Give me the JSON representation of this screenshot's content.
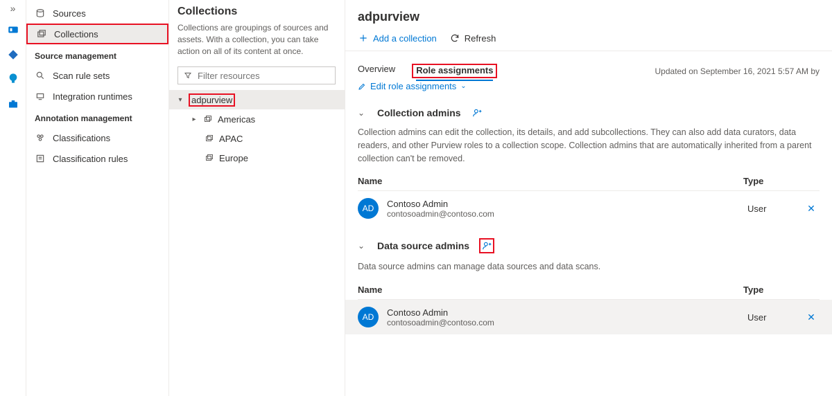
{
  "rail": {
    "expand_label": "Expand"
  },
  "sidebar": {
    "items": [
      {
        "label": "Sources"
      },
      {
        "label": "Collections"
      }
    ],
    "heading1": "Source management",
    "mgmt": [
      {
        "label": "Scan rule sets"
      },
      {
        "label": "Integration runtimes"
      }
    ],
    "heading2": "Annotation management",
    "ann": [
      {
        "label": "Classifications"
      },
      {
        "label": "Classification rules"
      }
    ]
  },
  "tree": {
    "title": "Collections",
    "subtitle": "Collections are groupings of sources and assets. With a collection, you can take action on all of its content at once.",
    "filter_placeholder": "Filter resources",
    "root": "adpurview",
    "children": [
      "Americas",
      "APAC",
      "Europe"
    ]
  },
  "main": {
    "title": "adpurview",
    "toolbar": {
      "add": "Add a collection",
      "refresh": "Refresh"
    },
    "tabs": {
      "overview": "Overview",
      "role": "Role assignments"
    },
    "updated": "Updated on September 16, 2021 5:57 AM by",
    "edit": "Edit role assignments",
    "sec1": {
      "title": "Collection admins",
      "desc": "Collection admins can edit the collection, its details, and add subcollections. They can also add data curators, data readers, and other Purview roles to a collection scope. Collection admins that are automatically inherited from a parent collection can't be removed.",
      "name_col": "Name",
      "type_col": "Type",
      "row": {
        "initials": "AD",
        "name": "Contoso Admin",
        "email": "contosoadmin@contoso.com",
        "type": "User"
      }
    },
    "sec2": {
      "title": "Data source admins",
      "desc": "Data source admins can manage data sources and data scans.",
      "name_col": "Name",
      "type_col": "Type",
      "row": {
        "initials": "AD",
        "name": "Contoso Admin",
        "email": "contosoadmin@contoso.com",
        "type": "User"
      }
    }
  }
}
